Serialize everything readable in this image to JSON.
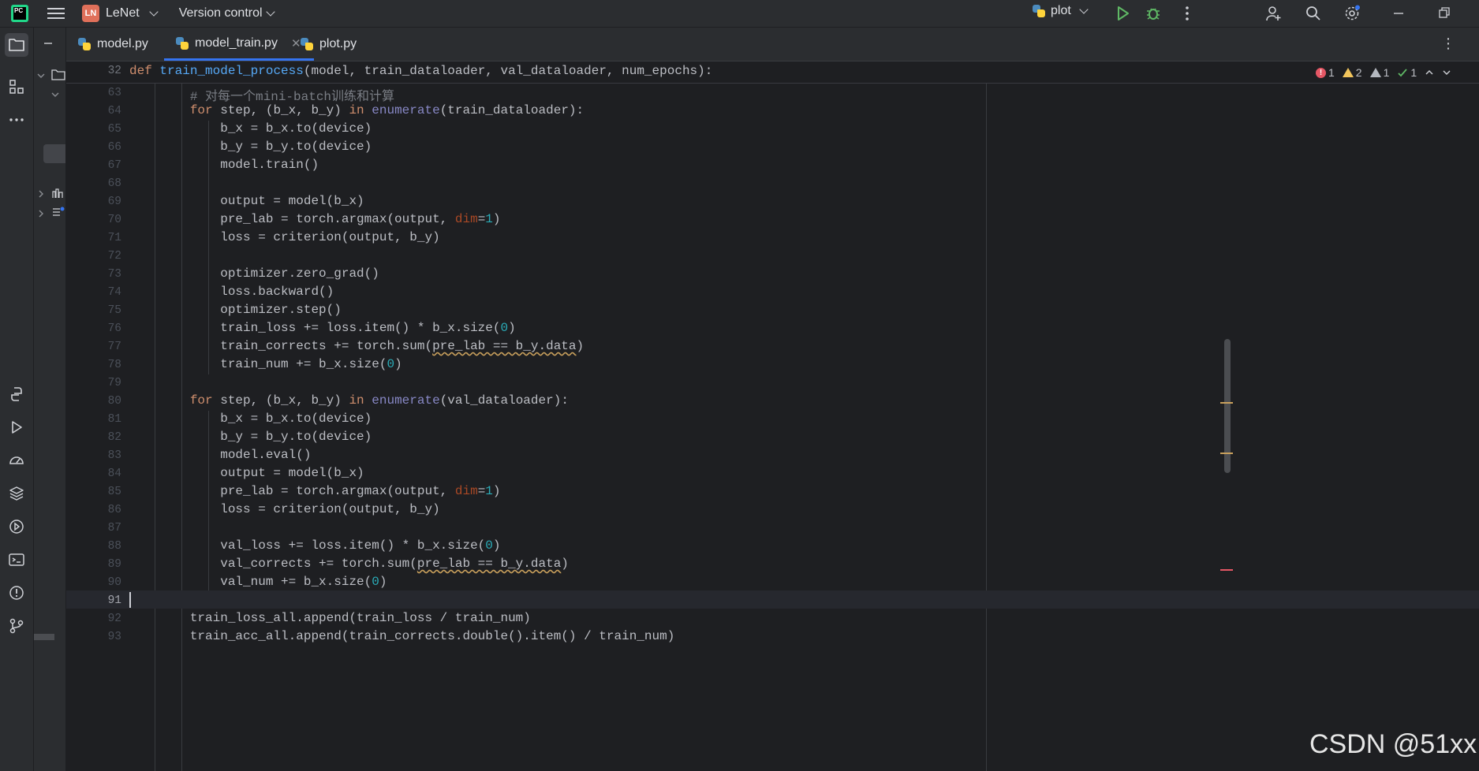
{
  "titlebar": {
    "project_badge": "LN",
    "project_name": "LeNet",
    "version_control": "Version control",
    "run_config": "plot"
  },
  "tabs": [
    {
      "label": "model.py",
      "active": false
    },
    {
      "label": "model_train.py",
      "active": true
    },
    {
      "label": "plot.py",
      "active": false
    }
  ],
  "sticky_line": {
    "number": "32",
    "def": "def",
    "name": "train_model_process",
    "params": "(model, train_dataloader, val_dataloader, num_epochs):"
  },
  "inspection": {
    "errors": "1",
    "warnings": "2",
    "weak_warnings": "1",
    "ok": "1"
  },
  "code_lines": [
    {
      "n": "63",
      "text": "        # 对每一个mini-batch训练和计算"
    },
    {
      "n": "64",
      "text": "        for step, (b_x, b_y) in enumerate(train_dataloader):"
    },
    {
      "n": "65",
      "text": "            b_x = b_x.to(device)"
    },
    {
      "n": "66",
      "text": "            b_y = b_y.to(device)"
    },
    {
      "n": "67",
      "text": "            model.train()"
    },
    {
      "n": "68",
      "text": ""
    },
    {
      "n": "69",
      "text": "            output = model(b_x)"
    },
    {
      "n": "70",
      "text": "            pre_lab = torch.argmax(output, dim=1)"
    },
    {
      "n": "71",
      "text": "            loss = criterion(output, b_y)"
    },
    {
      "n": "72",
      "text": ""
    },
    {
      "n": "73",
      "text": "            optimizer.zero_grad()"
    },
    {
      "n": "74",
      "text": "            loss.backward()"
    },
    {
      "n": "75",
      "text": "            optimizer.step()"
    },
    {
      "n": "76",
      "text": "            train_loss += loss.item() * b_x.size(0)"
    },
    {
      "n": "77",
      "text": "            train_corrects += torch.sum(pre_lab == b_y.data)"
    },
    {
      "n": "78",
      "text": "            train_num += b_x.size(0)"
    },
    {
      "n": "79",
      "text": ""
    },
    {
      "n": "80",
      "text": "        for step, (b_x, b_y) in enumerate(val_dataloader):"
    },
    {
      "n": "81",
      "text": "            b_x = b_x.to(device)"
    },
    {
      "n": "82",
      "text": "            b_y = b_y.to(device)"
    },
    {
      "n": "83",
      "text": "            model.eval()"
    },
    {
      "n": "84",
      "text": "            output = model(b_x)"
    },
    {
      "n": "85",
      "text": "            pre_lab = torch.argmax(output, dim=1)"
    },
    {
      "n": "86",
      "text": "            loss = criterion(output, b_y)"
    },
    {
      "n": "87",
      "text": ""
    },
    {
      "n": "88",
      "text": "            val_loss += loss.item() * b_x.size(0)"
    },
    {
      "n": "89",
      "text": "            val_corrects += torch.sum(pre_lab == b_y.data)"
    },
    {
      "n": "90",
      "text": "            val_num += b_x.size(0)"
    },
    {
      "n": "91",
      "text": ""
    },
    {
      "n": "92",
      "text": "        train_loss_all.append(train_loss / train_num)"
    },
    {
      "n": "93",
      "text": "        train_acc_all.append(train_corrects.double().item() / train_num)"
    }
  ],
  "current_line": "91",
  "watermark": "CSDN @51xx",
  "colors": {
    "accent": "#3574f0",
    "background": "#1e1f22",
    "panel": "#2b2d30"
  }
}
